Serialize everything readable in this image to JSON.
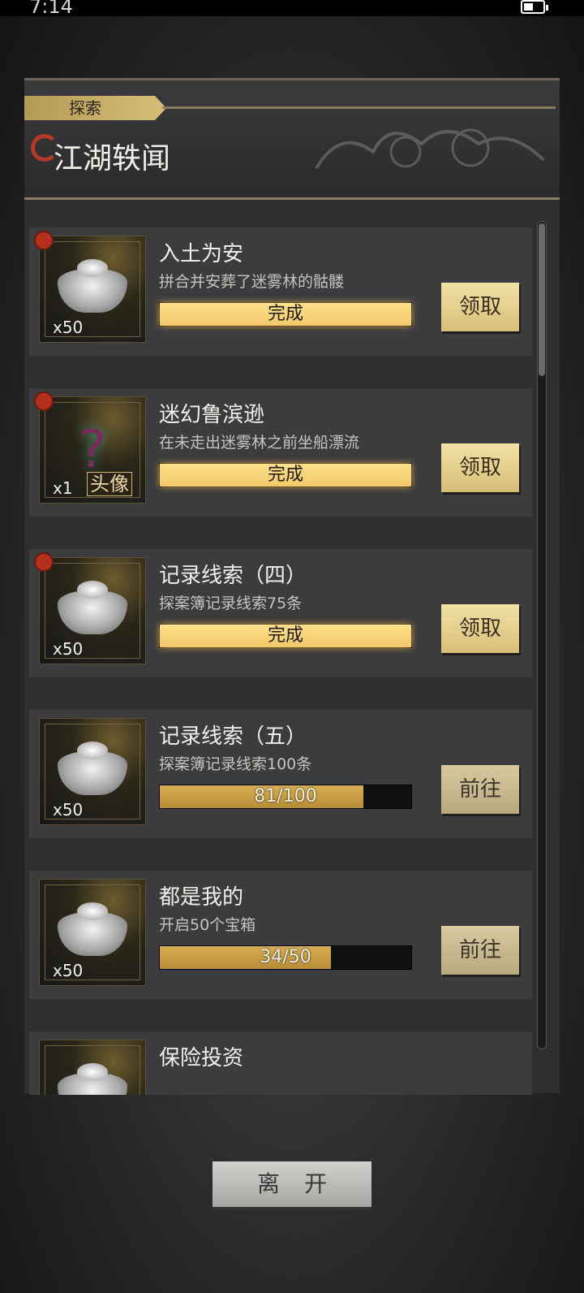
{
  "status_bar": {
    "time": "7:14"
  },
  "tab": {
    "label": "探索"
  },
  "header": {
    "title": "江湖轶闻"
  },
  "quests": [
    {
      "title": "入土为安",
      "description": "拼合并安葬了迷雾林的骷髅",
      "reward_count": "x50",
      "reward_icon": "silver-ingot-icon",
      "progress_text": "完成",
      "progress_fraction": 1.0,
      "completed": true,
      "action_label": "领取",
      "has_alert": true
    },
    {
      "title": "迷幻鲁滨逊",
      "description": "在未走出迷雾林之前坐船漂流",
      "reward_count": "x1",
      "reward_icon": "mystery-avatar-icon",
      "reward_tag": "头像",
      "progress_text": "完成",
      "progress_fraction": 1.0,
      "completed": true,
      "action_label": "领取",
      "has_alert": true
    },
    {
      "title": "记录线索（四）",
      "description": "探案簿记录线索75条",
      "reward_count": "x50",
      "reward_icon": "silver-ingot-icon",
      "progress_text": "完成",
      "progress_fraction": 1.0,
      "completed": true,
      "action_label": "领取",
      "has_alert": true
    },
    {
      "title": "记录线索（五）",
      "description": "探案簿记录线索100条",
      "reward_count": "x50",
      "reward_icon": "silver-ingot-icon",
      "progress_text": "81/100",
      "progress_fraction": 0.81,
      "completed": false,
      "action_label": "前往",
      "has_alert": false
    },
    {
      "title": "都是我的",
      "description": "开启50个宝箱",
      "reward_count": "x50",
      "reward_icon": "silver-ingot-icon",
      "progress_text": "34/50",
      "progress_fraction": 0.68,
      "completed": false,
      "action_label": "前往",
      "has_alert": false
    },
    {
      "title": "保险投资",
      "description": "",
      "reward_count": "",
      "reward_icon": "silver-ingot-icon",
      "progress_text": "",
      "progress_fraction": 0,
      "completed": false,
      "action_label": "",
      "has_alert": false
    }
  ],
  "footer": {
    "leave_label": "离开"
  },
  "colors": {
    "accent_gold": "#d8bd78",
    "alert_red": "#b4301a",
    "progress_done": "#f2c86a",
    "progress_partial": "#c89a42"
  }
}
